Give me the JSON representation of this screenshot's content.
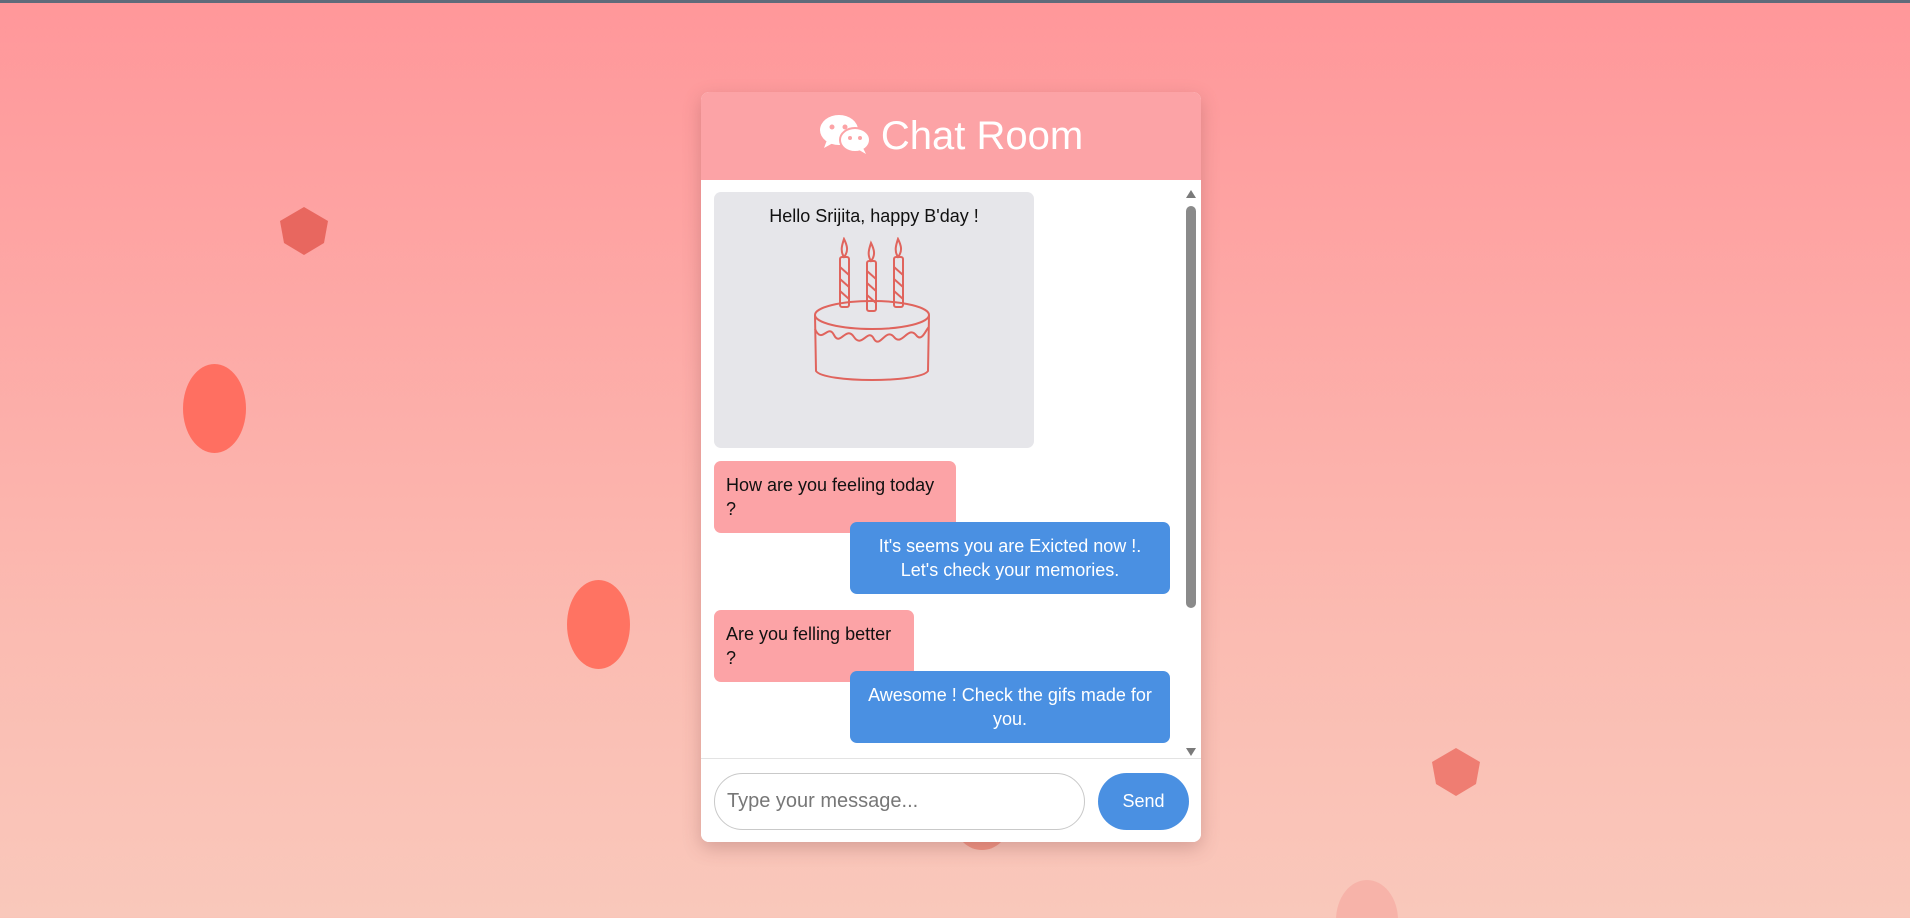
{
  "colors": {
    "header": "#fca3a6",
    "incoming_bubble": "#fca3a6",
    "outgoing_bubble": "#4a90e2",
    "send_button": "#4a90e2",
    "card_background": "#e6e6ea"
  },
  "header": {
    "icon": "wechat-icon",
    "title": "Chat Room"
  },
  "messages": {
    "greeting": "Hello Srijita, happy B'day !",
    "greeting_image": "birthday-cake-icon",
    "m1": "How are you feeling today ?",
    "m2_line1": "It's seems you are Exicted now !.",
    "m2_line2": "Let's check your memories.",
    "m3": "Are you felling better ?",
    "m4_line1": "Awesome ! Check the gifs made for",
    "m4_line2": "you."
  },
  "composer": {
    "placeholder": "Type your message...",
    "value": "",
    "send_label": "Send"
  }
}
